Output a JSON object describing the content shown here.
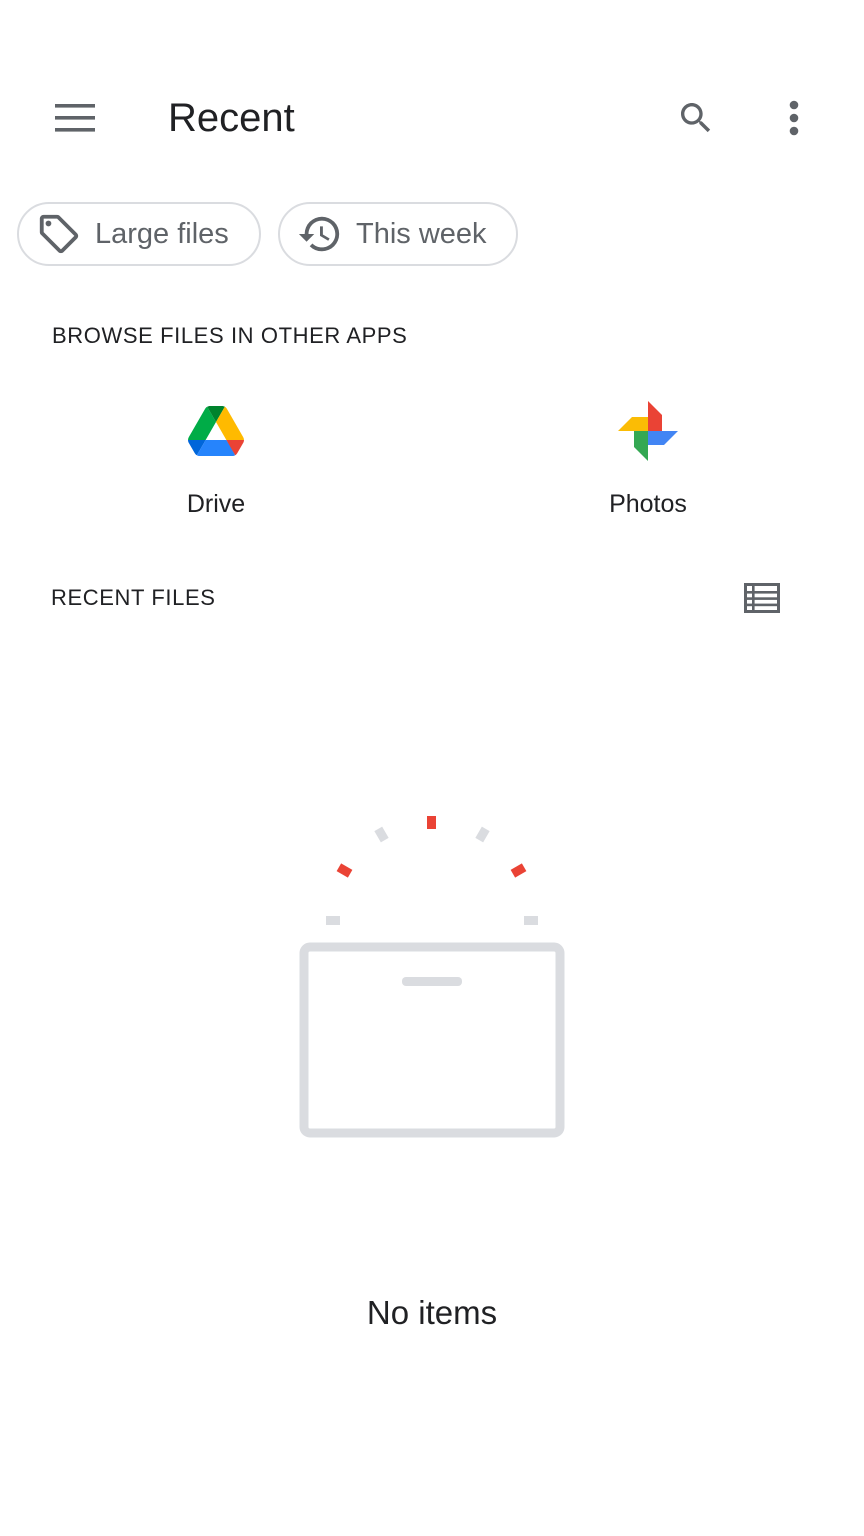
{
  "app_bar": {
    "title": "Recent",
    "menu_icon": "hamburger-menu-icon",
    "search_icon": "search-icon",
    "more_icon": "more-vert-icon"
  },
  "chips": [
    {
      "label": "Large files",
      "icon": "label-tag-icon"
    },
    {
      "label": "This week",
      "icon": "history-icon"
    }
  ],
  "browse_section": {
    "header": "BROWSE FILES IN OTHER APPS",
    "apps": [
      {
        "label": "Drive",
        "icon": "google-drive-icon"
      },
      {
        "label": "Photos",
        "icon": "google-photos-icon"
      }
    ]
  },
  "recent_section": {
    "header": "RECENT FILES",
    "view_toggle_icon": "list-view-icon"
  },
  "empty_state": {
    "text": "No items",
    "icon": "empty-box-illustration"
  },
  "colors": {
    "text_primary": "#202124",
    "text_secondary": "#5f6368",
    "chip_border": "#dadce0",
    "illustration_gray": "#dadce0",
    "illustration_accent": "#ea4335"
  }
}
